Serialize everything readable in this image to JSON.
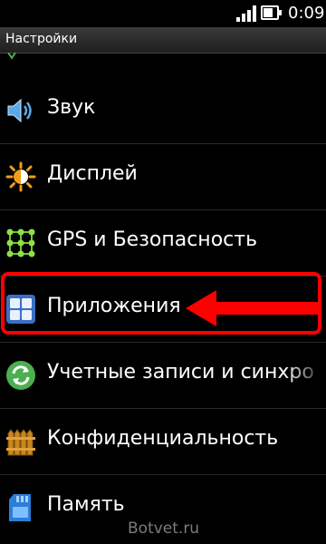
{
  "status_bar": {
    "time": "0:09"
  },
  "title_bar": {
    "title": "Настройки"
  },
  "settings": {
    "items": [
      {
        "label": "Звук",
        "icon": "speaker-icon"
      },
      {
        "label": "Дисплей",
        "icon": "brightness-icon"
      },
      {
        "label": "GPS и Безопасность",
        "icon": "gps-grid-icon"
      },
      {
        "label": "Приложения",
        "icon": "apps-grid-icon"
      },
      {
        "label": "Учетные записи и синхро",
        "icon": "sync-icon"
      },
      {
        "label": "Конфиденциальность",
        "icon": "fence-icon"
      },
      {
        "label": "Память",
        "icon": "sd-card-icon"
      }
    ]
  },
  "annotation": {
    "highlighted_item": "Приложения",
    "color": "#ff0000"
  },
  "watermark": {
    "text": "Botvet.ru"
  }
}
